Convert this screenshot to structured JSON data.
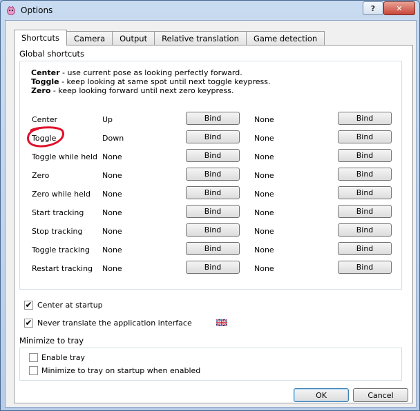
{
  "window": {
    "title": "Options",
    "help_glyph": "?",
    "close_glyph": "✕",
    "app_icon": "app-icon"
  },
  "tabs": [
    "Shortcuts",
    "Camera",
    "Output",
    "Relative translation",
    "Game detection"
  ],
  "global_shortcuts": {
    "title": "Global shortcuts",
    "help": [
      {
        "key": "Center",
        "text": " - use current pose as looking perfectly forward."
      },
      {
        "key": "Toggle",
        "text": " - keep looking at same spot until next toggle keypress."
      },
      {
        "key": "Zero",
        "text": " - keep looking forward until next zero keypress."
      }
    ],
    "rows": [
      {
        "action": "Center",
        "key1": "Up",
        "key2": "None"
      },
      {
        "action": "Toggle",
        "key1": "Down",
        "key2": "None"
      },
      {
        "action": "Toggle while held",
        "key1": "None",
        "key2": "None"
      },
      {
        "action": "Zero",
        "key1": "None",
        "key2": "None"
      },
      {
        "action": "Zero while held",
        "key1": "None",
        "key2": "None"
      },
      {
        "action": "Start tracking",
        "key1": "None",
        "key2": "None"
      },
      {
        "action": "Stop tracking",
        "key1": "None",
        "key2": "None"
      },
      {
        "action": "Toggle tracking",
        "key1": "None",
        "key2": "None"
      },
      {
        "action": "Restart tracking",
        "key1": "None",
        "key2": "None"
      }
    ],
    "bind_label": "Bind"
  },
  "options": {
    "center_at_startup": {
      "label": "Center at startup",
      "checked": true
    },
    "never_translate": {
      "label": "Never translate the application interface",
      "checked": true,
      "flag_icon": "uk-flag-icon"
    }
  },
  "tray": {
    "title": "Minimize to tray",
    "enable_tray": {
      "label": "Enable tray",
      "checked": false
    },
    "minimize_on_startup": {
      "label": "Minimize to tray on startup when enabled",
      "checked": false
    }
  },
  "buttons": {
    "ok": "OK",
    "cancel": "Cancel"
  },
  "colors": {
    "annotation": "#e0102a",
    "title_bar": "#b7cde8"
  }
}
